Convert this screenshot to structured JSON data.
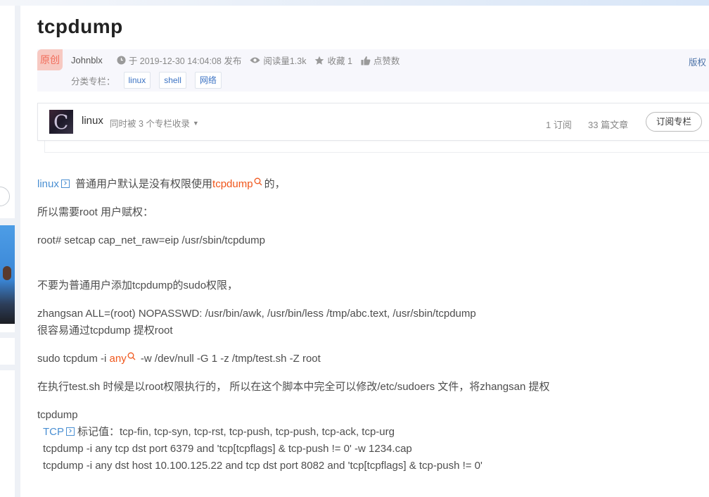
{
  "article": {
    "title": "tcpdump",
    "badge": "原创",
    "author": "Johnblx",
    "published": "于 2019-12-30 14:04:08 发布",
    "views": "阅读量1.3k",
    "favorites": "收藏 1",
    "likes": "点赞数",
    "copyright": "版权",
    "category_label": "分类专栏：",
    "tags": [
      "linux",
      "shell",
      "网络"
    ]
  },
  "column": {
    "avatar_letter": "C",
    "name": "linux",
    "included": "同时被 3 个专栏收录",
    "subscribers": "1 订阅",
    "articles": "33 篇文章",
    "subscribe_button": "订阅专栏"
  },
  "content": {
    "p1": {
      "link": "linux",
      "text_a": "普通用户默认是没有权限使用",
      "kw": "tcpdump",
      "text_b": "的，"
    },
    "p2": "所以需要root 用户赋权：",
    "p3": "root#  setcap cap_net_raw=eip  /usr/sbin/tcpdump",
    "p4": "不要为普通用户添加tcpdump的sudo权限，",
    "p5a": "zhangsan ALL=(root) NOPASSWD:  /usr/bin/awk, /usr/bin/less /tmp/abc.text, /usr/sbin/tcpdump",
    "p5b": "很容易通过tcpdump 提权root",
    "p6": {
      "a": "sudo tcpdum -i  ",
      "kw": "any",
      "b": "  -w /dev/null -G 1 -z /tmp/test.sh -Z root"
    },
    "p7": "在执行test.sh 时候是以root权限执行的，  所以在这个脚本中完全可以修改/etc/sudoers 文件，将zhangsan 提权",
    "p8": "tcpdump",
    "p9": {
      "link": "TCP",
      "text": "标记值：tcp-fin, tcp-syn, tcp-rst, tcp-push, tcp-push, tcp-ack, tcp-urg"
    },
    "p10": "tcpdump -i any tcp dst port 6379  and 'tcp[tcpflags] & tcp-push != 0' -w 1234.cap",
    "p11": "tcpdump -i any dst host 10.100.125.22 and tcp dst port 8082  and 'tcp[tcpflags] & tcp-push != 0'"
  },
  "colors": {
    "link": "#4a8fd2",
    "keyword": "#f0561b",
    "badge_bg": "#f7c9c2",
    "badge_text": "#f26d5b"
  }
}
